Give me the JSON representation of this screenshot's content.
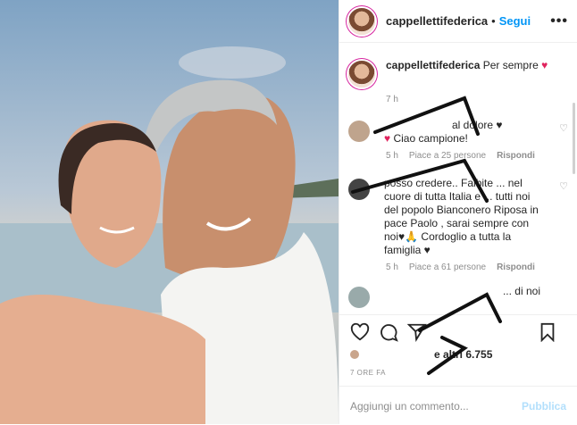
{
  "header": {
    "username": "cappellettifederica",
    "follow_label": "Segui",
    "more": "•••"
  },
  "caption": {
    "username": "cappellettifederica",
    "text": "Per sempre",
    "emoji": "♥",
    "time": "7 h"
  },
  "comments": [
    {
      "text_a": "al dolore",
      "emoji_a": "♥",
      "text_b": "Ciao campione!",
      "emoji_b": "♥",
      "time": "5 h",
      "likes": "Piace a 25 persone",
      "reply": "Rispondi"
    },
    {
      "text": "posso credere.. Faibite ... nel cuore di tutta Italia e ... tutti noi del popolo Bianconero",
      "rest": "Riposa in pace Paolo , sarai sempre con noi♥🙏 Cordoglio a tutta la famiglia ♥",
      "time": "5 h",
      "likes": "Piace a 61 persone",
      "reply": "Rispondi"
    },
    {
      "text": "... di noi"
    }
  ],
  "likes_text": "e altri 6.755",
  "time_ago": "7 ORE FA",
  "add_comment": {
    "placeholder": "Aggiungi un commento...",
    "publish": "Pubblica"
  },
  "icons": [
    "heart-icon",
    "comment-icon",
    "share-icon",
    "bookmark-icon"
  ]
}
